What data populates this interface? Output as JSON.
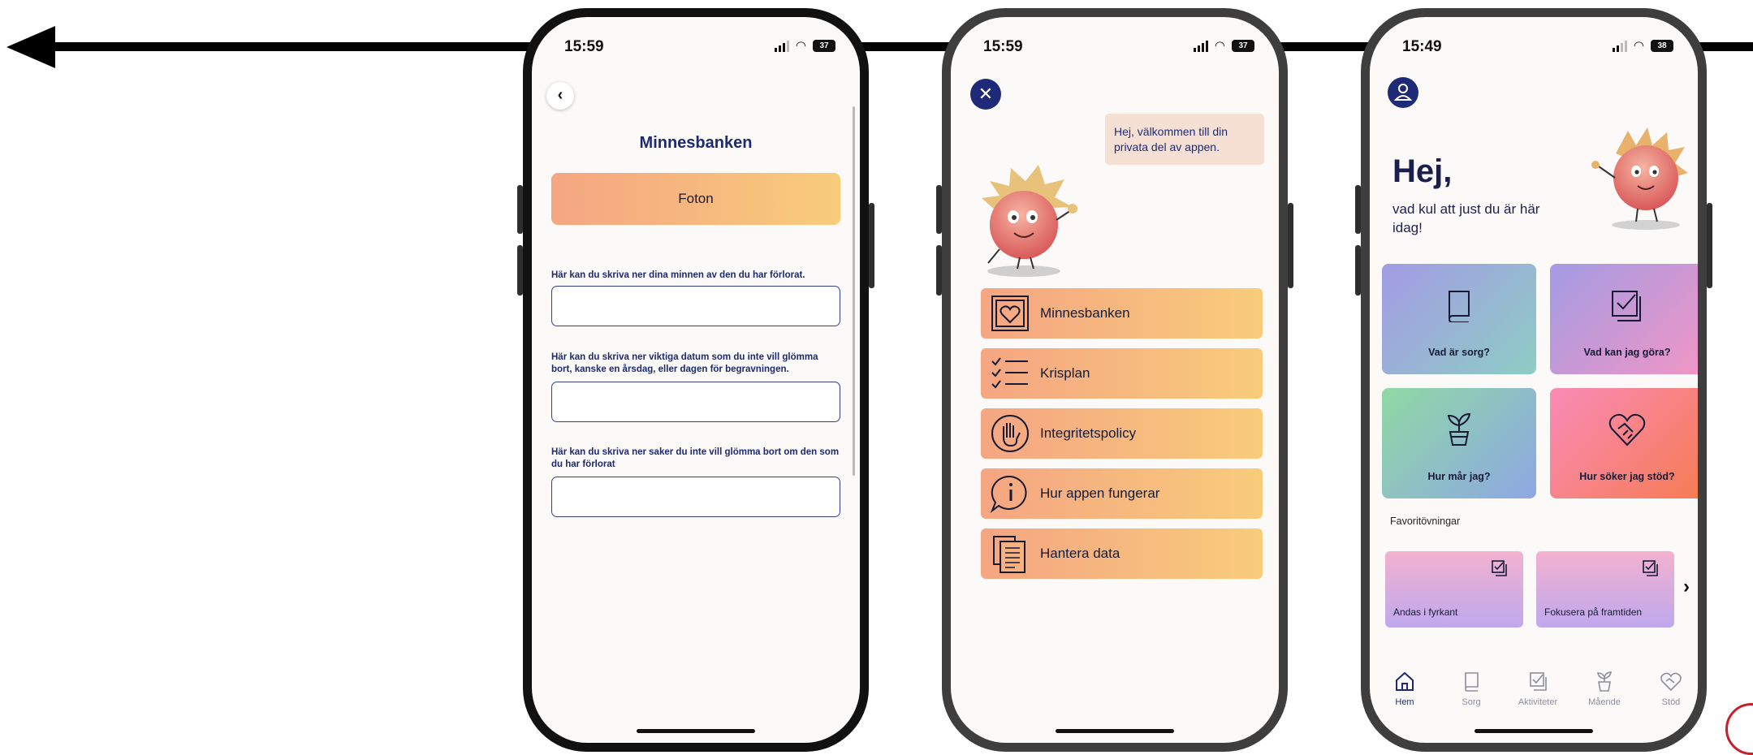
{
  "status_bars": [
    {
      "time": "15:59",
      "battery": "37"
    },
    {
      "time": "15:59",
      "battery": "37"
    },
    {
      "time": "15:49",
      "battery": "38"
    }
  ],
  "minnesbanken_screen": {
    "title": "Minnesbanken",
    "photos_button": "Foton",
    "fields": [
      {
        "label": "Här kan du skriva ner dina minnen av den du har förlorat.",
        "value": ""
      },
      {
        "label": "Här kan du skriva ner viktiga datum som du inte vill glömma bort, kanske en årsdag, eller dagen för begravningen.",
        "value": ""
      },
      {
        "label": "Här kan du skriva ner saker du inte vill glömma bort om den som du har förlorat",
        "value": ""
      }
    ]
  },
  "private_menu_screen": {
    "welcome_message": "Hej, välkommen till din privata del av appen.",
    "items": [
      {
        "label": "Minnesbanken",
        "icon": "heart-frame-icon"
      },
      {
        "label": "Krisplan",
        "icon": "checklist-icon"
      },
      {
        "label": "Integritetspolicy",
        "icon": "hand-icon"
      },
      {
        "label": "Hur appen fungerar",
        "icon": "info-bubble-icon"
      },
      {
        "label": "Hantera data",
        "icon": "documents-icon"
      }
    ]
  },
  "home_screen": {
    "greeting": "Hej,",
    "subtitle": "vad kul att just du är här idag!",
    "tiles": [
      {
        "label": "Vad är sorg?",
        "icon": "book-icon"
      },
      {
        "label": "Vad kan jag göra?",
        "icon": "checkbox-stack-icon"
      },
      {
        "label": "Hur mår jag?",
        "icon": "plant-icon"
      },
      {
        "label": "Hur söker jag stöd?",
        "icon": "handshake-heart-icon"
      }
    ],
    "favorites_title": "Favoritövningar",
    "favorites": [
      {
        "label": "Andas i fyrkant"
      },
      {
        "label": "Fokusera på framtiden"
      }
    ],
    "tabs": [
      {
        "label": "Hem",
        "icon": "home-icon",
        "active": true
      },
      {
        "label": "Sorg",
        "icon": "book-icon",
        "active": false
      },
      {
        "label": "Aktiviteter",
        "icon": "checkbox-icon",
        "active": false
      },
      {
        "label": "Mående",
        "icon": "plant-icon",
        "active": false
      },
      {
        "label": "Stöd",
        "icon": "handshake-heart-icon",
        "active": false
      }
    ]
  },
  "colors": {
    "navy": "#1e2a78",
    "peach_start": "#f5a582",
    "peach_end": "#f8cc7b"
  }
}
